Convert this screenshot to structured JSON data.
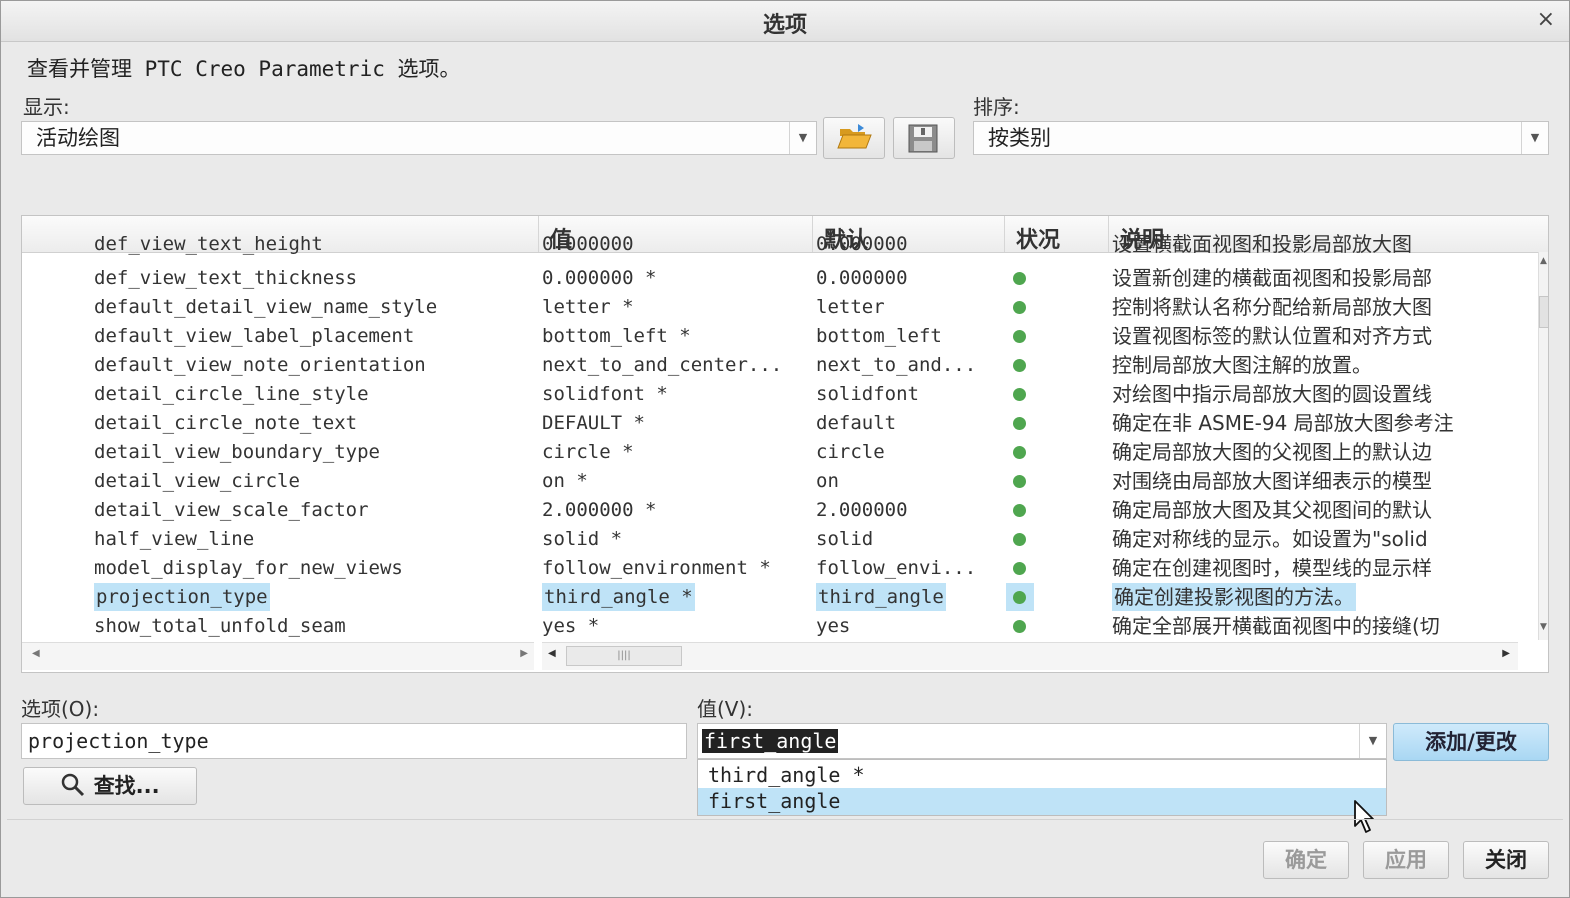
{
  "window": {
    "title": "选项",
    "close": "×"
  },
  "description": "查看并管理 PTC Creo Parametric 选项。",
  "display": {
    "label": "显示:",
    "value": "活动绘图"
  },
  "sort": {
    "label": "排序:",
    "value": "按类别"
  },
  "table": {
    "headers": {
      "name": "",
      "value": "值",
      "default": "默认",
      "status": "状况",
      "desc": "说明"
    },
    "partial_row": {
      "name": "def_view_text_height",
      "value": "0.000000",
      "default": "0.000000",
      "desc": "设置横截面视图和投影局部放大图"
    },
    "rows": [
      {
        "name": "def_view_text_thickness",
        "value": "0.000000 *",
        "default": "0.000000",
        "desc": "设置新创建的横截面视图和投影局部"
      },
      {
        "name": "default_detail_view_name_style",
        "value": "letter *",
        "default": "letter",
        "desc": "控制将默认名称分配给新局部放大图"
      },
      {
        "name": "default_view_label_placement",
        "value": "bottom_left *",
        "default": "bottom_left",
        "desc": "设置视图标签的默认位置和对齐方式"
      },
      {
        "name": "default_view_note_orientation",
        "value": "next_to_and_center...",
        "default": "next_to_and...",
        "desc": "控制局部放大图注解的放置。"
      },
      {
        "name": "detail_circle_line_style",
        "value": "solidfont *",
        "default": "solidfont",
        "desc": "对绘图中指示局部放大图的圆设置线"
      },
      {
        "name": "detail_circle_note_text",
        "value": "DEFAULT *",
        "default": "default",
        "desc": "确定在非 ASME-94 局部放大图参考注"
      },
      {
        "name": "detail_view_boundary_type",
        "value": "circle *",
        "default": "circle",
        "desc": "确定局部放大图的父视图上的默认边"
      },
      {
        "name": "detail_view_circle",
        "value": "on *",
        "default": "on",
        "desc": "对围绕由局部放大图详细表示的模型"
      },
      {
        "name": "detail_view_scale_factor",
        "value": "2.000000 *",
        "default": "2.000000",
        "desc": "确定局部放大图及其父视图间的默认"
      },
      {
        "name": "half_view_line",
        "value": "solid *",
        "default": "solid",
        "desc": "确定对称线的显示。如设置为\"solid"
      },
      {
        "name": "model_display_for_new_views",
        "value": "follow_environment *",
        "default": "follow_envi...",
        "desc": "确定在创建视图时，模型线的显示样"
      },
      {
        "name": "projection_type",
        "value": "third_angle *",
        "default": "third_angle",
        "desc": "确定创建投影视图的方法。",
        "selected": true
      },
      {
        "name": "show_total_unfold_seam",
        "value": "yes *",
        "default": "yes",
        "desc": "确定全部展开横截面视图中的接缝(切"
      }
    ]
  },
  "option": {
    "label": "选项(O):",
    "value": "projection_type"
  },
  "value_field": {
    "label": "值(V):",
    "value": "first_angle",
    "options": [
      "third_angle *",
      "first_angle"
    ]
  },
  "buttons": {
    "find": "查找...",
    "add_change": "添加/更改",
    "ok": "确定",
    "apply": "应用",
    "close": "关闭"
  }
}
